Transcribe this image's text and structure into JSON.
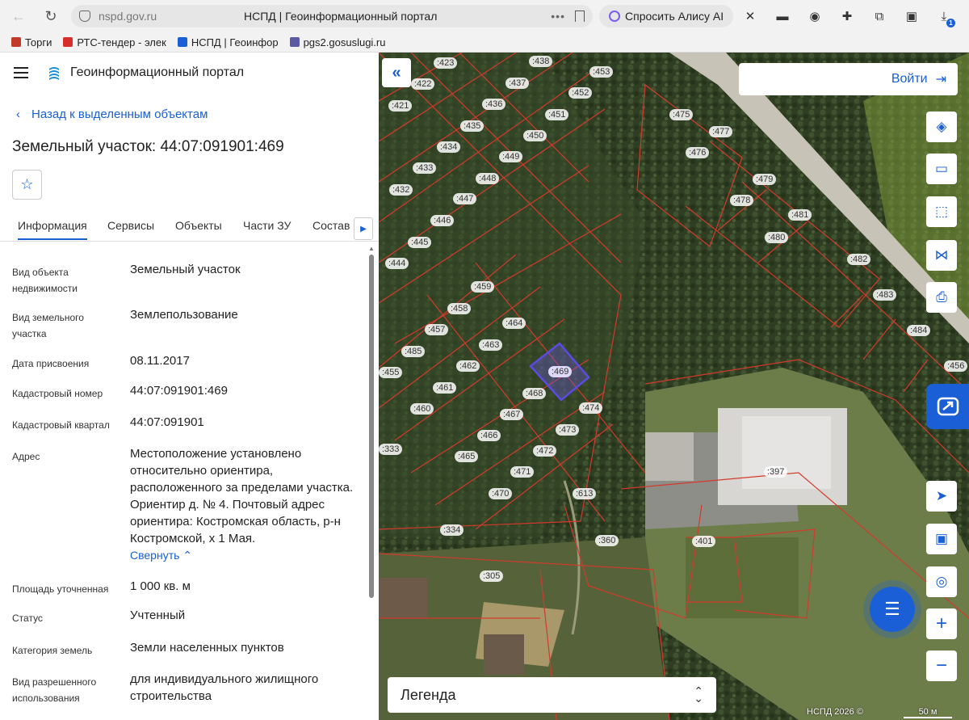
{
  "browser": {
    "url": "nspd.gov.ru",
    "page_title": "НСПД | Геоинформационный портал",
    "alisa_label": "Спросить Алису AI",
    "notification_count": "1",
    "bookmarks": [
      {
        "label": "Торги",
        "color": "#c0392b"
      },
      {
        "label": "РТС-тендер - элек",
        "color": "#d62d2d"
      },
      {
        "label": "НСПД | Геоинфор",
        "color": "#1a5fd6"
      },
      {
        "label": "pgs2.gosuslugi.ru",
        "color": "#5a5aa0"
      }
    ]
  },
  "portal": {
    "title": "Геоинформационный портал",
    "back_label": "Назад к выделенным объектам",
    "object_title": "Земельный участок: 44:07:091901:469"
  },
  "tabs": [
    "Информация",
    "Сервисы",
    "Объекты",
    "Части ЗУ",
    "Состав"
  ],
  "properties": [
    {
      "key": "Вид объекта недвижимости",
      "value": "Земельный участок"
    },
    {
      "key": "Вид земельного участка",
      "value": "Землепользование"
    },
    {
      "key": "Дата присвоения",
      "value": "08.11.2017"
    },
    {
      "key": "Кадастровый номер",
      "value": "44:07:091901:469"
    },
    {
      "key": "Кадастровый квартал",
      "value": "44:07:091901"
    },
    {
      "key": "Адрес",
      "value": "Местоположение установлено относительно ориентира, расположенного за пределами участка. Ориентир д. № 4. Почтовый адрес ориентира: Костромская область, р-н Костромской, х 1 Мая."
    },
    {
      "key": "Площадь уточненная",
      "value": "1 000 кв. м"
    },
    {
      "key": "Статус",
      "value": "Учтенный"
    },
    {
      "key": "Категория земель",
      "value": "Земли населенных пунктов"
    },
    {
      "key": "Вид разрешенного использования",
      "value": "для индивидуального жилищного строительства"
    }
  ],
  "collapse_label": "Свернуть",
  "map": {
    "login_label": "Войти",
    "legend_label": "Легенда",
    "copyright": "НСПД 2026 ©",
    "scale_label": "50 м",
    "selected_parcel": ":469",
    "parcel_labels": [
      ":423",
      ":438",
      ":453",
      ":422",
      ":437",
      ":452",
      ":421",
      ":436",
      ":451",
      ":435",
      ":450",
      ":434",
      ":449",
      ":433",
      ":448",
      ":432",
      ":447",
      ":446",
      ":445",
      ":444",
      ":475",
      ":477",
      ":476",
      ":479",
      ":478",
      ":481",
      ":480",
      ":482",
      ":483",
      ":484",
      ":459",
      ":458",
      ":464",
      ":457",
      ":463",
      ":485",
      ":462",
      ":455",
      ":461",
      ":468",
      ":460",
      ":467",
      ":474",
      ":473",
      ":466",
      ":472",
      ":465",
      ":471",
      ":470",
      ":613",
      ":333",
      ":334",
      ":360",
      ":401",
      ":397",
      ":305",
      ":456"
    ]
  }
}
